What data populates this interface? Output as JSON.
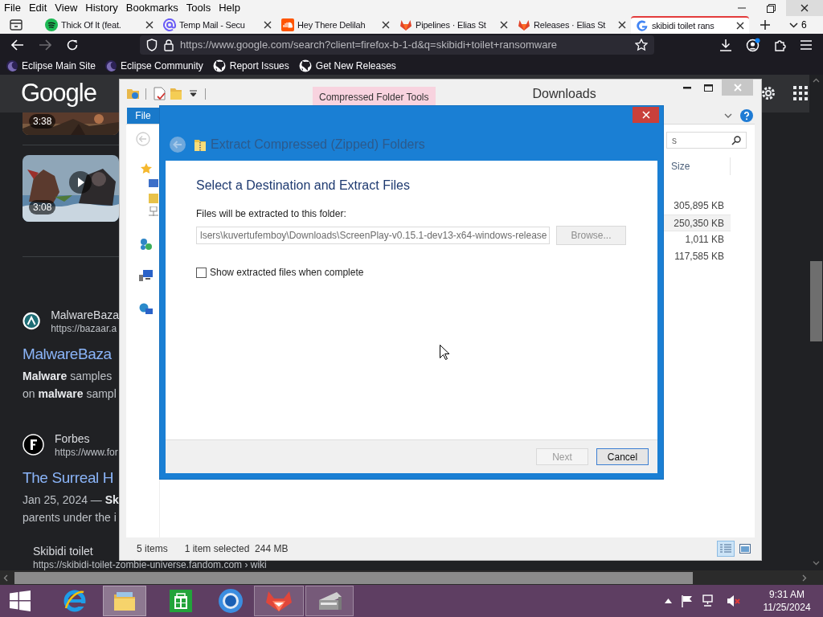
{
  "browser": {
    "menu": [
      "File",
      "Edit",
      "View",
      "History",
      "Bookmarks",
      "Tools",
      "Help"
    ],
    "tabs": [
      {
        "title": "Thick Of It (feat.",
        "selected": false
      },
      {
        "title": "Temp Mail - Secu",
        "selected": false
      },
      {
        "title": "Hey There Delilah",
        "selected": false
      },
      {
        "title": "Pipelines · Elias St",
        "selected": false
      },
      {
        "title": "Releases · Elias St",
        "selected": false
      },
      {
        "title": "skibidi toilet rans",
        "selected": true
      }
    ],
    "tab_count": "6",
    "url": "https://www.google.com/search?client=firefox-b-1-d&q=skibidi+toilet+ransomware",
    "bookmarks": [
      "Eclipse Main Site",
      "Eclipse Community",
      "Report Issues",
      "Get New Releases"
    ]
  },
  "google": {
    "logo": "Google",
    "videos": [
      {
        "duration": "3:38"
      },
      {
        "duration": "3:08"
      }
    ],
    "results": [
      {
        "site": "MalwareBaza",
        "url": "https://bazaar.a",
        "title": "MalwareBaza",
        "snippet": [
          "**Malware** samples",
          "on **malware** sampl"
        ]
      },
      {
        "site": "Forbes",
        "url": "https://www.for",
        "title": "The Surreal H",
        "snippet": [
          "Jan 25, 2024 — **Sk**",
          "parents under the i"
        ]
      },
      {
        "site": "Skibidi toilet",
        "url": "https://skibidi-toilet-zombie-universe.fandom.com › wiki"
      }
    ]
  },
  "explorer": {
    "context_tab": "Compressed Folder Tools",
    "title": "Downloads",
    "file_tab": "File",
    "search_text": "s",
    "size_header": "Size",
    "rows": [
      {
        "size": "305,895 KB",
        "selected": false
      },
      {
        "size": "250,350 KB",
        "selected": true
      },
      {
        "size": "1,011 KB",
        "selected": false
      },
      {
        "size": "117,585 KB",
        "selected": false
      }
    ],
    "status": {
      "items": "5 items",
      "selection": "1 item selected  244 MB"
    }
  },
  "dialog": {
    "title": "Extract Compressed (Zipped) Folders",
    "heading": "Select a Destination and Extract Files",
    "path_label": "Files will be extracted to this folder:",
    "path_field": {
      "value": "lsers\\kuvertufemboy\\Downloads\\ScreenPlay-v0.15.1-dev13-x64-windows-release",
      "disabled": true
    },
    "browse": {
      "label": "Browse...",
      "disabled": true
    },
    "show_files": {
      "label": "Show extracted files when complete",
      "checked": false
    },
    "buttons": [
      {
        "label": "Next",
        "disabled": true
      },
      {
        "label": "Cancel",
        "disabled": false
      }
    ]
  },
  "taskbar": {
    "apps": [
      {
        "running": false,
        "selected": false
      },
      {
        "running": true,
        "selected": true
      },
      {
        "running": false,
        "selected": false
      },
      {
        "running": false,
        "selected": false
      },
      {
        "running": true,
        "selected": false
      },
      {
        "running": true,
        "selected": false
      }
    ],
    "time": "9:31 AM",
    "date": "11/25/2024"
  }
}
